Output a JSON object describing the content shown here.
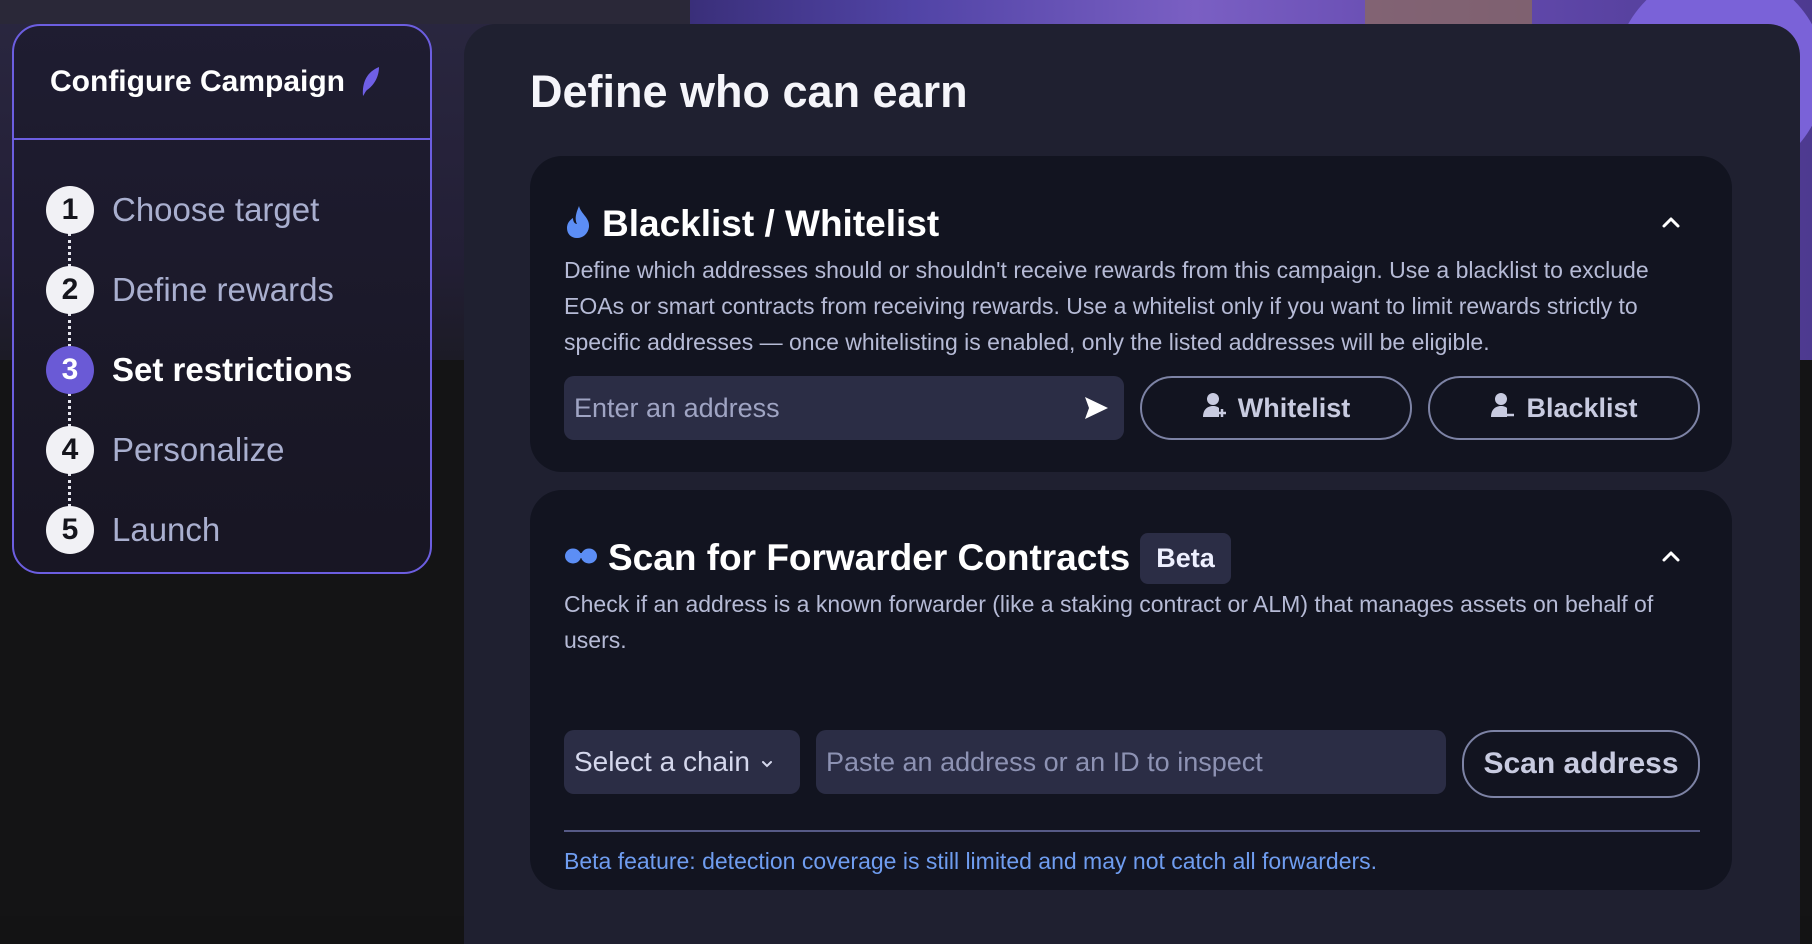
{
  "sidebar": {
    "title": "Configure Campaign",
    "steps": [
      {
        "num": "1",
        "label": "Choose target"
      },
      {
        "num": "2",
        "label": "Define rewards"
      },
      {
        "num": "3",
        "label": "Set restrictions"
      },
      {
        "num": "4",
        "label": "Personalize"
      },
      {
        "num": "5",
        "label": "Launch"
      }
    ],
    "active_step": 3
  },
  "main": {
    "title": "Define who can earn",
    "blacklist_card": {
      "title": "Blacklist / Whitelist",
      "description": "Define which addresses should or shouldn't receive rewards from this campaign. Use a blacklist to exclude EOAs or smart contracts from receiving rewards. Use a whitelist only if you want to limit rewards strictly to specific addresses — once whitelisting is enabled, only the listed addresses will be eligible.",
      "address_placeholder": "Enter an address",
      "address_value": "",
      "whitelist_label": "Whitelist",
      "blacklist_label": "Blacklist"
    },
    "forwarder_card": {
      "title": "Scan for Forwarder Contracts",
      "badge": "Beta",
      "description": "Check if an address is a known forwarder (like a staking contract or ALM) that manages assets on behalf of users.",
      "chain_select": "Select a chain",
      "inspect_placeholder": "Paste an address or an ID to inspect",
      "inspect_value": "",
      "scan_label": "Scan address",
      "beta_note": "Beta feature: detection coverage is still limited and may not catch all forwarders."
    }
  },
  "colors": {
    "accent": "#6c5ee0",
    "active_step": "#6a5ad6",
    "note_link": "#6f9df0",
    "card_bg": "#121420",
    "panel_bg": "#1f2030"
  },
  "icons": {
    "sidebar_title": "feather-icon",
    "blacklist_card": "flame-icon",
    "forwarder_card": "binoculars-icon",
    "send": "send-icon",
    "whitelist": "user-plus-icon",
    "blacklist": "user-minus-icon",
    "collapse": "chevron-up-icon",
    "chain_dropdown": "chevron-down-icon"
  }
}
